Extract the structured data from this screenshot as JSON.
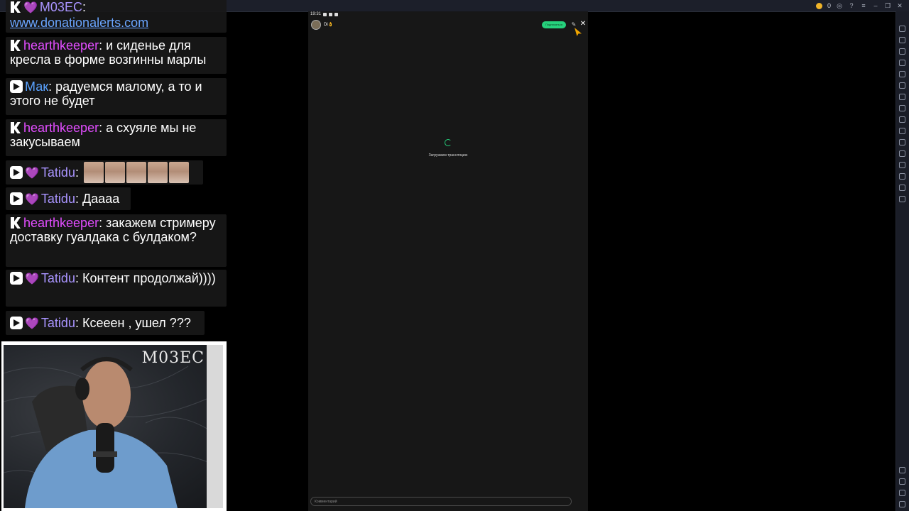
{
  "window": {
    "coins": "0",
    "controls": [
      "profile-icon",
      "help-icon",
      "menu-icon",
      "minimize-icon",
      "restore-icon",
      "close-icon"
    ]
  },
  "chat": {
    "messages": [
      {
        "platform": "kick",
        "heart": true,
        "user": "М03ЕС",
        "sep": ":",
        "text": "",
        "link": "www.donationalerts.com"
      },
      {
        "platform": "kick",
        "heart": false,
        "user": "hearthkeeper",
        "sep": ":",
        "text": " и сиденье для кресла в форме возгинны марлы"
      },
      {
        "platform": "vk",
        "heart": false,
        "user": "Мак",
        "sep": ":",
        "text": " радуемся малому, а то и этого не будет"
      },
      {
        "platform": "kick",
        "heart": false,
        "user": "hearthkeeper",
        "sep": ":",
        "text": " а схуяле мы не закусываем"
      },
      {
        "platform": "vk",
        "heart": true,
        "user": "Tatidu",
        "sep": ":",
        "text": " ",
        "emotes": 5
      },
      {
        "platform": "vk",
        "heart": true,
        "user": "Tatidu",
        "sep": ":",
        "text": " Даааа"
      },
      {
        "platform": "kick",
        "heart": false,
        "user": "hearthkeeper",
        "sep": ":",
        "text": " закажем стримеру доставку гуалдака с булдаком?"
      },
      {
        "platform": "vk",
        "heart": true,
        "user": "Tatidu",
        "sep": ":",
        "text": " Контент продолжай))))"
      },
      {
        "platform": "vk",
        "heart": true,
        "user": "Tatidu",
        "sep": ":",
        "text": " Ксееен , ушел ???"
      }
    ]
  },
  "webcam": {
    "overlay_name": "М03ЕС"
  },
  "phone": {
    "status_time": "19:31",
    "host_name": "Di👌",
    "subscribe_label": "Подписаться",
    "loading_text": "Загружаем трансляцию",
    "comment_placeholder": "Комментарий"
  },
  "colors": {
    "kick_user": "#e24dff",
    "vk_user_mak": "#5aa2ff",
    "vk_user_tatidu": "#a994ff",
    "accent_green": "#26d17c"
  }
}
